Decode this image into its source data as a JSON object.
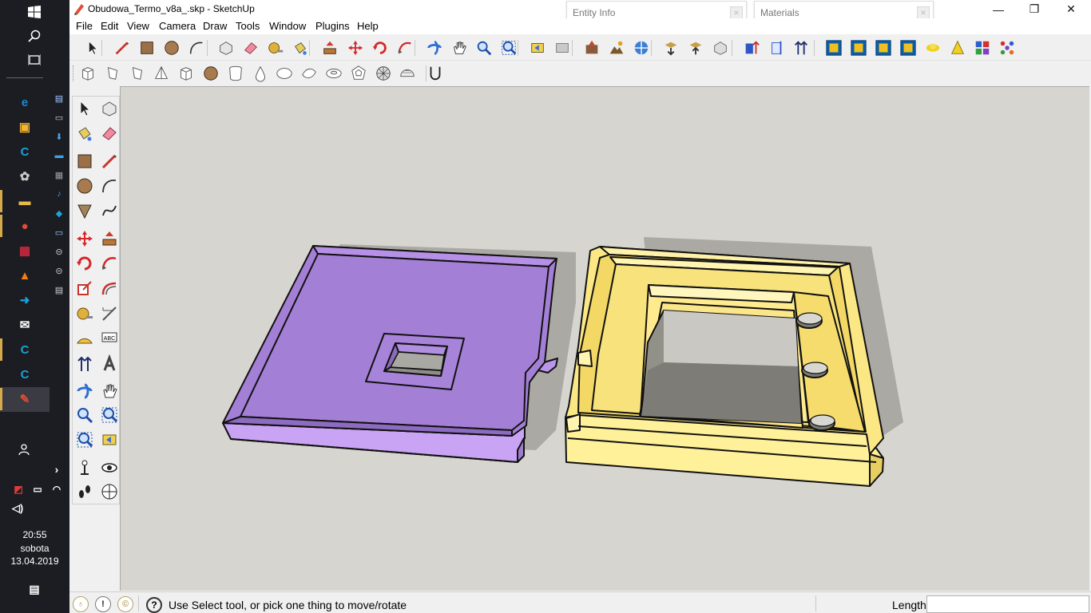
{
  "taskbar": {
    "start_icon": "windows-logo-icon",
    "search_icon": "search-icon",
    "task_view_icon": "task-view-icon",
    "pinned_apps": [
      {
        "name": "edge-icon",
        "glyph": "e",
        "color": "#1a8ad4"
      },
      {
        "name": "store-icon",
        "glyph": "▣",
        "color": "#f3b52d"
      },
      {
        "name": "c-app-icon",
        "glyph": "C",
        "color": "#19a2d8"
      },
      {
        "name": "settings-app-icon",
        "glyph": "✿",
        "color": "#c9c9c9"
      },
      {
        "name": "file-explorer-icon",
        "glyph": "▬",
        "color": "#e8b84a"
      },
      {
        "name": "chrome-icon",
        "glyph": "●",
        "color": "#e04b3b"
      },
      {
        "name": "save-app-icon",
        "glyph": "▦",
        "color": "#c9283e"
      },
      {
        "name": "vlc-icon",
        "glyph": "▲",
        "color": "#f07f12"
      },
      {
        "name": "arrow-app-icon",
        "glyph": "➜",
        "color": "#19a2d8"
      },
      {
        "name": "mail-icon",
        "glyph": "✉",
        "color": "#ffffff"
      },
      {
        "name": "c-app-icon-2",
        "glyph": "C",
        "color": "#19a2d8"
      },
      {
        "name": "c-app-icon-3",
        "glyph": "C",
        "color": "#19a2d8"
      },
      {
        "name": "sketchup-icon",
        "glyph": "✎",
        "color": "#e24b32"
      }
    ],
    "people_icon": "people-icon",
    "show_more_icon": "chevron-right-icon",
    "tray_icons": [
      "antivirus-icon",
      "battery-icon",
      "wifi-icon",
      "volume-icon"
    ],
    "clock": {
      "time": "20:55",
      "day": "sobota",
      "date": "13.04.2019"
    },
    "notifications_icon": "notifications-icon"
  },
  "window": {
    "title": "Obudowa_Termo_v8a_.skp - SketchUp",
    "controls": {
      "minimize": "—",
      "maximize": "❐",
      "close": "✕"
    }
  },
  "trays": [
    {
      "label": "Entity Info"
    },
    {
      "label": "Materials"
    }
  ],
  "menu": [
    "File",
    "Edit",
    "View",
    "Camera",
    "Draw",
    "Tools",
    "Window",
    "Plugins",
    "Help"
  ],
  "toolbar_large": [
    "select-icon",
    "line-icon",
    "rectangle-icon",
    "circle-icon",
    "arc-icon",
    "make-component-icon",
    "eraser-icon",
    "tape-measure-icon",
    "paint-bucket-icon",
    "push-pull-icon",
    "move-icon",
    "rotate-icon",
    "follow-me-icon",
    "orbit-icon",
    "pan-icon",
    "zoom-icon",
    "zoom-extents-icon",
    "previous-view-icon",
    "next-view-icon",
    "add-location-icon",
    "toggle-terrain-icon",
    "photo-textures-icon",
    "get-models-icon",
    "share-model-icon",
    "share-component-icon",
    "add-on-icon",
    "dimensions-icon",
    "axes-icon",
    "plugin-1-icon",
    "plugin-2-icon",
    "plugin-3-icon",
    "plugin-4-icon",
    "sun-icon",
    "cone-icon",
    "palette-icon",
    "dots-icon"
  ],
  "toolbar_shapes": [
    "box-shape-icon",
    "prism-shape-icon",
    "wedge-shape-icon",
    "pyramid-shape-icon",
    "cube-shape-icon",
    "circle-shape-icon",
    "cylinder-shape-icon",
    "drop-shape-icon",
    "ellipse-shape-icon",
    "lens-shape-icon",
    "torus-shape-icon",
    "dodecahedron-shape-icon",
    "geosphere-shape-icon",
    "hemisphere-shape-icon",
    "magnet-icon"
  ],
  "palette": [
    [
      "select-tool-icon",
      "make-component-tool-icon"
    ],
    [
      "paint-bucket-tool-icon",
      "eraser-tool-icon"
    ],
    [
      "rectangle-tool-icon",
      "line-tool-icon"
    ],
    [
      "circle-tool-icon",
      "arc-tool-icon"
    ],
    [
      "polygon-tool-icon",
      "freehand-tool-icon"
    ],
    [
      "move-tool-icon",
      "push-pull-tool-icon"
    ],
    [
      "rotate-tool-icon",
      "follow-me-tool-icon"
    ],
    [
      "scale-tool-icon",
      "offset-tool-icon"
    ],
    [
      "tape-measure-tool-icon",
      "dimension-tool-icon"
    ],
    [
      "protractor-tool-icon",
      "text-tool-icon"
    ],
    [
      "axes-tool-icon",
      "3d-text-tool-icon"
    ],
    [
      "orbit-tool-icon",
      "pan-tool-icon"
    ],
    [
      "zoom-tool-icon",
      "zoom-window-tool-icon"
    ],
    [
      "zoom-extents-tool-icon",
      "previous-view-tool-icon"
    ],
    [
      "position-camera-tool-icon",
      "look-around-tool-icon"
    ],
    [
      "walk-tool-icon",
      "section-plane-tool-icon"
    ]
  ],
  "status": {
    "left_icons": [
      "geo-location-icon",
      "credits-icon",
      "sign-in-icon"
    ],
    "help_icon": "help-icon",
    "message": "Use Select tool, or pick one thing to move/rotate",
    "length_label": "Length",
    "length_value": ""
  },
  "colors": {
    "viewport": "#d6d5d0",
    "purple_part": "#a47fd6",
    "yellow_part": "#fbe885",
    "taskbar": "#1c1d23"
  }
}
